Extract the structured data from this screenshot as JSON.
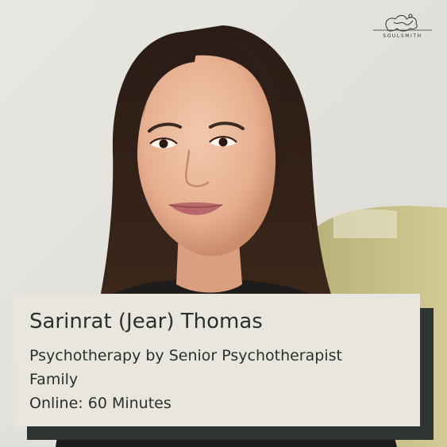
{
  "brand": {
    "logo_text": "SOULSMITH",
    "logo_icon": "soulsmith-scribble-logo-icon"
  },
  "photo": {
    "icon": "therapist-portrait-photo"
  },
  "card": {
    "name": "Sarinrat (Jear) Thomas",
    "service": "Psychotherapy by Senior Psychotherapist",
    "specialty": "Family",
    "session": "Online: 60 Minutes"
  },
  "colors": {
    "card_background": "#e9e6dd",
    "card_shadow": "#2e3433",
    "text": "#2c2f2f",
    "wall": "#e4e2dc",
    "sofa": "#cdc590"
  }
}
